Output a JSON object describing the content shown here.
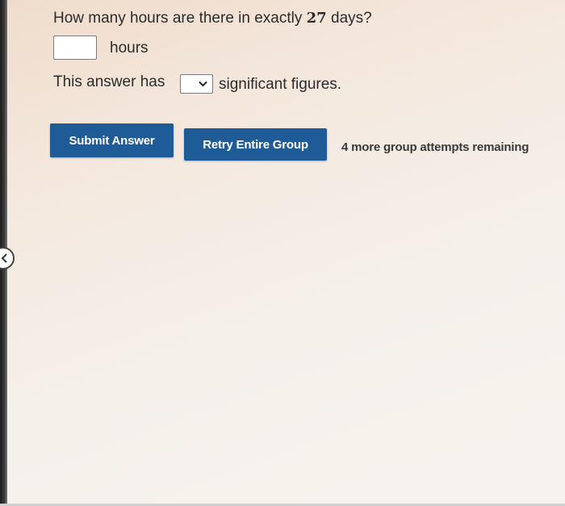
{
  "question": {
    "prefix": "How many hours are there in exactly",
    "number": "27",
    "suffix": "days?"
  },
  "answer": {
    "value": "",
    "placeholder": "",
    "unit": "hours"
  },
  "sigfigs": {
    "prefix": "This answer has",
    "selected": "",
    "suffix": "significant figures."
  },
  "actions": {
    "submit_label": "Submit Answer",
    "retry_label": "Retry Entire Group",
    "attempts_text": "4 more group attempts remaining"
  },
  "icons": {
    "dropdown": "chevron-down-icon",
    "collapse": "chevron-left-icon"
  },
  "colors": {
    "button": "#1f5b97",
    "button_text": "#ffffff"
  }
}
